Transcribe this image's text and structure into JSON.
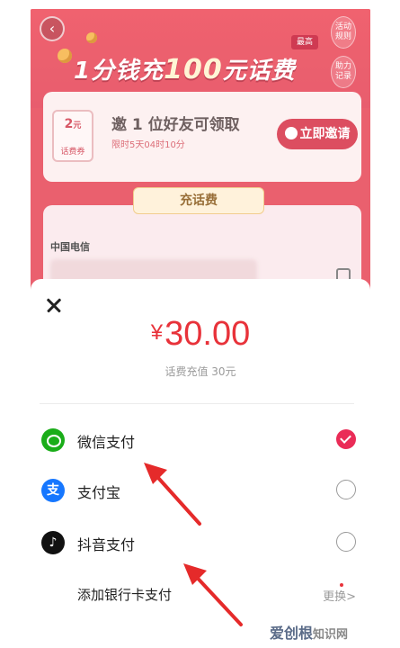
{
  "promo": {
    "back_icon": "back-arrow-icon",
    "best_tag": "最高",
    "title_prefix": "1分钱充",
    "title_num": "100",
    "title_suffix": "元话费",
    "rules_label": "活动规则",
    "records_label": "助力记录",
    "coupon_amount": "2",
    "coupon_unit": "元",
    "coupon_label": "话费券",
    "invite_text": "邀 1 位好友可领取",
    "invite_timer": "限时5天04时10分",
    "invite_button": "立即邀请",
    "recharge_tag": "充话费",
    "carrier": "中国电信"
  },
  "payment": {
    "currency": "¥",
    "amount": "30.00",
    "amount_sub": "话费充值 30元",
    "methods": [
      {
        "name": "微信支付",
        "icon": "wechat-pay-icon",
        "selected": true
      },
      {
        "name": "支付宝",
        "icon": "alipay-icon",
        "selected": false
      },
      {
        "name": "抖音支付",
        "icon": "douyin-pay-icon",
        "selected": false
      }
    ],
    "bank_label": "添加银行卡支付",
    "change_label": "更换",
    "change_arrow": ">"
  },
  "colors": {
    "accent_red": "#e8323a",
    "promo_bg": "#e84a5a",
    "selected_check": "#ea2c57"
  },
  "watermark": {
    "brand": "爱创根",
    "site": "知识网"
  }
}
